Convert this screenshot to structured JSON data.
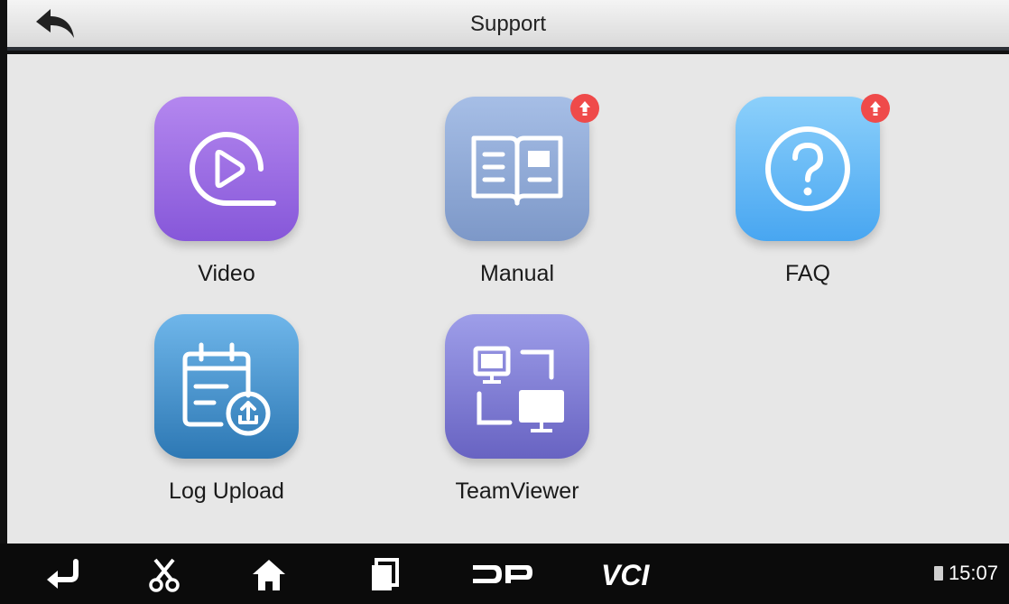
{
  "header": {
    "title": "Support"
  },
  "apps": [
    {
      "label": "Video",
      "badge": false
    },
    {
      "label": "Manual",
      "badge": true
    },
    {
      "label": "FAQ",
      "badge": true
    },
    {
      "label": "Log Upload",
      "badge": false
    },
    {
      "label": "TeamViewer",
      "badge": false
    }
  ],
  "navbar": {
    "vci_label": "VCI",
    "dp_label": "DP",
    "time": "15:07",
    "icons": [
      "back-arrow-icon",
      "scissors-icon",
      "home-icon",
      "recent-apps-icon",
      "dp-logo-icon",
      "vci-logo-icon",
      "battery-icon"
    ]
  },
  "colors": {
    "accent_badge": "#ef4a4a",
    "video": "#9a6ae3",
    "manual": "#8fabd8",
    "faq": "#5fb3f5",
    "log_upload": "#3d8bc8",
    "teamviewer": "#7f7bd4"
  }
}
